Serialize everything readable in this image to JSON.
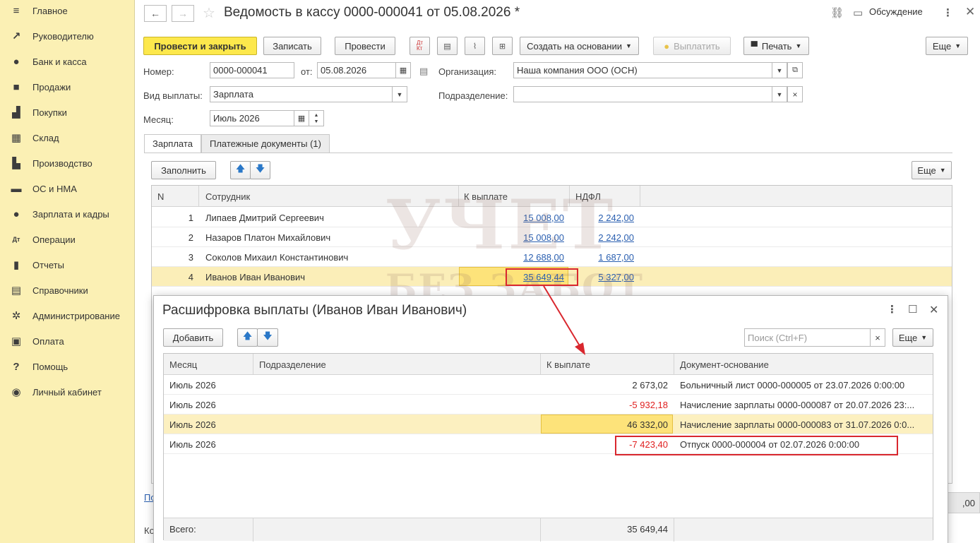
{
  "sidebar": {
    "items": [
      {
        "label": "Главное",
        "icon": "menu-icon",
        "glyph": "≡"
      },
      {
        "label": "Руководителю",
        "icon": "trend-icon",
        "glyph": "↗"
      },
      {
        "label": "Банк и касса",
        "icon": "coin-icon",
        "glyph": "●"
      },
      {
        "label": "Продажи",
        "icon": "bag-icon",
        "glyph": "■"
      },
      {
        "label": "Покупки",
        "icon": "cart-icon",
        "glyph": "▟"
      },
      {
        "label": "Склад",
        "icon": "warehouse-icon",
        "glyph": "▦"
      },
      {
        "label": "Производство",
        "icon": "factory-icon",
        "glyph": "▙"
      },
      {
        "label": "ОС и НМА",
        "icon": "truck-icon",
        "glyph": "▬"
      },
      {
        "label": "Зарплата и кадры",
        "icon": "person-icon",
        "glyph": "●"
      },
      {
        "label": "Операции",
        "icon": "dt-kt-icon",
        "glyph": "Дт"
      },
      {
        "label": "Отчеты",
        "icon": "bar-chart-icon",
        "glyph": "▮"
      },
      {
        "label": "Справочники",
        "icon": "book-icon",
        "glyph": "▤"
      },
      {
        "label": "Администрирование",
        "icon": "gear-icon",
        "glyph": "✲"
      },
      {
        "label": "Оплата",
        "icon": "payment-icon",
        "glyph": "▣"
      },
      {
        "label": "Помощь",
        "icon": "help-icon",
        "glyph": "?"
      },
      {
        "label": "Личный кабинет",
        "icon": "user-circle-icon",
        "glyph": "◉"
      }
    ]
  },
  "header": {
    "title": "Ведомость в кассу 0000-000041 от 05.08.2026 *",
    "discussion": "Обсуждение"
  },
  "toolbar": {
    "post_close": "Провести и закрыть",
    "save": "Записать",
    "post": "Провести",
    "create_based": "Создать на основании",
    "pay": "Выплатить",
    "print": "Печать",
    "more": "Еще"
  },
  "form": {
    "number_label": "Номер:",
    "number": "0000-000041",
    "from_label": "от:",
    "date": "05.08.2026",
    "org_label": "Организация:",
    "org": "Наша компания ООО (ОСН)",
    "pay_type_label": "Вид выплаты:",
    "pay_type": "Зарплата",
    "division_label": "Подразделение:",
    "division": "",
    "month_label": "Месяц:",
    "month": "Июль 2026"
  },
  "tabs": [
    {
      "label": "Зарплата"
    },
    {
      "label": "Платежные документы (1)"
    }
  ],
  "grid_toolbar": {
    "fill": "Заполнить",
    "more": "Еще"
  },
  "grid": {
    "headers": {
      "n": "N",
      "employee": "Сотрудник",
      "to_pay": "К выплате",
      "ndfl": "НДФЛ"
    },
    "rows": [
      {
        "n": "1",
        "employee": "Липаев Дмитрий Сергеевич",
        "to_pay": "15 008,00",
        "ndfl": "2 242,00"
      },
      {
        "n": "2",
        "employee": "Назаров Платон Михайлович",
        "to_pay": "15 008,00",
        "ndfl": "2 242,00"
      },
      {
        "n": "3",
        "employee": "Соколов Михаил Константинович",
        "to_pay": "12 688,00",
        "ndfl": "1 687,00"
      },
      {
        "n": "4",
        "employee": "Иванов Иван Иванович",
        "to_pay": "35 649,44",
        "ndfl": "5 327,00"
      }
    ]
  },
  "bottom": {
    "link_fragment": "По",
    "label_fragment": "Ко",
    "total_fragment": ",00"
  },
  "watermark": {
    "line1": "УЧЕТ",
    "line2": "БЕЗ ЗАБОТ"
  },
  "popup": {
    "title": "Расшифровка выплаты (Иванов Иван Иванович)",
    "add": "Добавить",
    "search_placeholder": "Поиск (Ctrl+F)",
    "more": "Еще",
    "headers": {
      "month": "Месяц",
      "division": "Подразделение",
      "to_pay": "К выплате",
      "basis": "Документ-основание"
    },
    "rows": [
      {
        "month": "Июль 2026",
        "division": "",
        "to_pay": "2 673,02",
        "negative": false,
        "basis": "Больничный лист 0000-000005 от 23.07.2026 0:00:00"
      },
      {
        "month": "Июль 2026",
        "division": "",
        "to_pay": "-5 932,18",
        "negative": true,
        "basis": "Начисление зарплаты 0000-000087 от 20.07.2026 23:..."
      },
      {
        "month": "Июль 2026",
        "division": "",
        "to_pay": "46 332,00",
        "negative": false,
        "basis": "Начисление зарплаты 0000-000083 от 31.07.2026 0:0..."
      },
      {
        "month": "Июль 2026",
        "division": "",
        "to_pay": "-7 423,40",
        "negative": true,
        "basis": "Отпуск 0000-000004 от 02.07.2026 0:00:00"
      }
    ],
    "total_label": "Всего:",
    "total": "35 649,44"
  },
  "colors": {
    "sidebar_bg": "#fbf0b4",
    "primary_button": "#fde84c",
    "selected_row": "#fbeeb8",
    "negative_text": "#e02020",
    "annotation_red": "#d9272e",
    "link": "#2a5fb0"
  }
}
